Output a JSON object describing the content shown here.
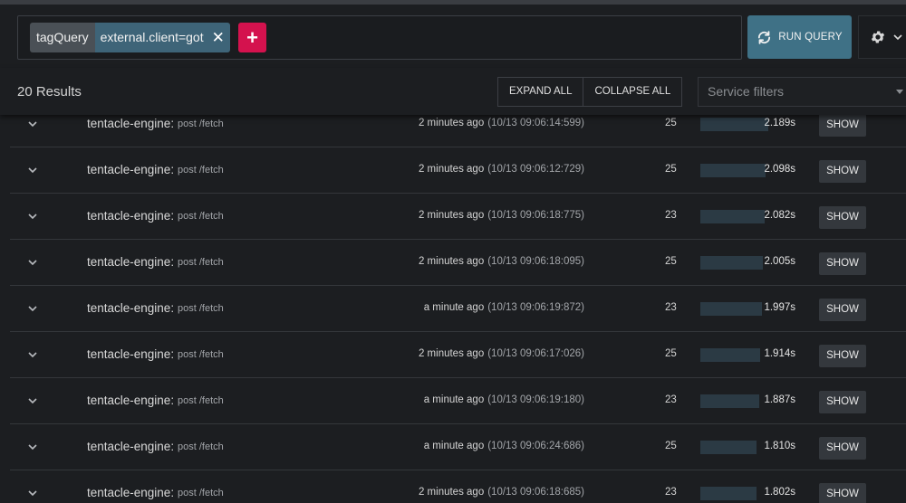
{
  "query": {
    "chip_key": "tagQuery",
    "chip_value": "external.client=got",
    "close_glyph": "✕",
    "add_glyph": "+",
    "run_label": "RUN QUERY"
  },
  "results": {
    "count_label": "20 Results",
    "expand_label": "EXPAND ALL",
    "collapse_label": "COLLAPSE ALL",
    "filter_placeholder": "Service filters"
  },
  "colors": {
    "accent_run": "#3f7186",
    "accent_add": "#d4124e",
    "bar": "#2b3a44"
  },
  "rows": [
    {
      "service": "tentacle-engine:",
      "operation": "post /fetch",
      "relative": "2 minutes ago",
      "absolute": "(10/13 09:06:14:599)",
      "spans": "25",
      "duration": "2.189s",
      "duration_value": 2.189,
      "show": "SHOW"
    },
    {
      "service": "tentacle-engine:",
      "operation": "post /fetch",
      "relative": "2 minutes ago",
      "absolute": "(10/13 09:06:12:729)",
      "spans": "25",
      "duration": "2.098s",
      "duration_value": 2.098,
      "show": "SHOW"
    },
    {
      "service": "tentacle-engine:",
      "operation": "post /fetch",
      "relative": "2 minutes ago",
      "absolute": "(10/13 09:06:18:775)",
      "spans": "23",
      "duration": "2.082s",
      "duration_value": 2.082,
      "show": "SHOW"
    },
    {
      "service": "tentacle-engine:",
      "operation": "post /fetch",
      "relative": "2 minutes ago",
      "absolute": "(10/13 09:06:18:095)",
      "spans": "25",
      "duration": "2.005s",
      "duration_value": 2.005,
      "show": "SHOW"
    },
    {
      "service": "tentacle-engine:",
      "operation": "post /fetch",
      "relative": "a minute ago",
      "absolute": "(10/13 09:06:19:872)",
      "spans": "23",
      "duration": "1.997s",
      "duration_value": 1.997,
      "show": "SHOW"
    },
    {
      "service": "tentacle-engine:",
      "operation": "post /fetch",
      "relative": "2 minutes ago",
      "absolute": "(10/13 09:06:17:026)",
      "spans": "25",
      "duration": "1.914s",
      "duration_value": 1.914,
      "show": "SHOW"
    },
    {
      "service": "tentacle-engine:",
      "operation": "post /fetch",
      "relative": "a minute ago",
      "absolute": "(10/13 09:06:19:180)",
      "spans": "23",
      "duration": "1.887s",
      "duration_value": 1.887,
      "show": "SHOW"
    },
    {
      "service": "tentacle-engine:",
      "operation": "post /fetch",
      "relative": "a minute ago",
      "absolute": "(10/13 09:06:24:686)",
      "spans": "25",
      "duration": "1.810s",
      "duration_value": 1.81,
      "show": "SHOW"
    },
    {
      "service": "tentacle-engine:",
      "operation": "post /fetch",
      "relative": "2 minutes ago",
      "absolute": "(10/13 09:06:18:685)",
      "spans": "23",
      "duration": "1.802s",
      "duration_value": 1.802,
      "show": "SHOW"
    }
  ]
}
